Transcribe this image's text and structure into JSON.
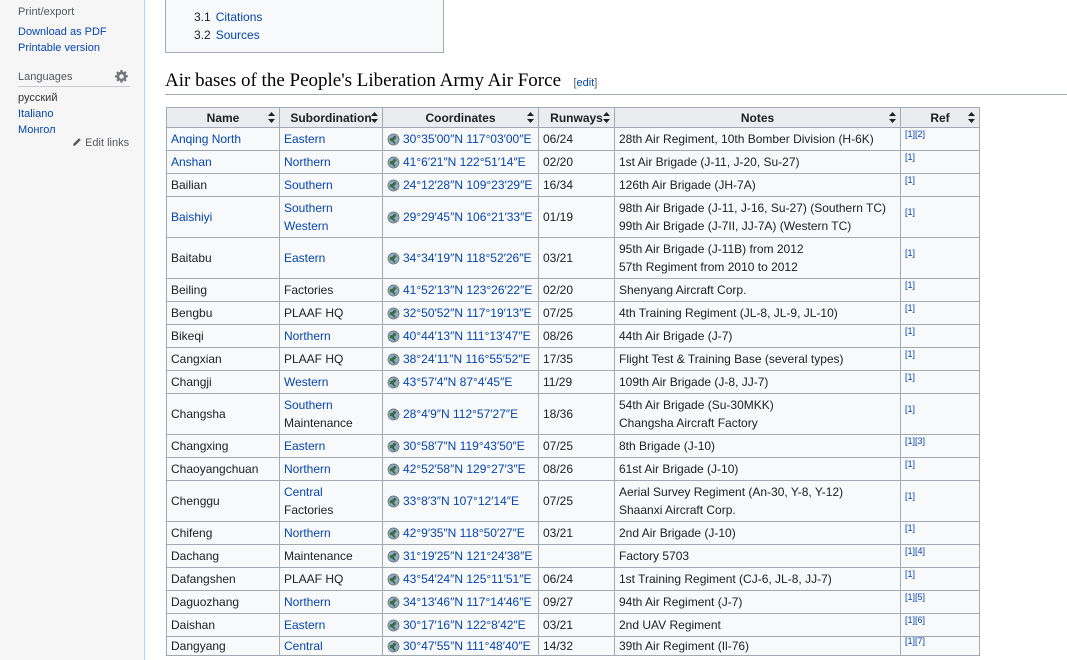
{
  "sidebar": {
    "print_heading": "Print/export",
    "print_links": [
      "Download as PDF",
      "Printable version"
    ],
    "languages_heading": "Languages",
    "languages": [
      "русский",
      "Italiano",
      "Монгол"
    ],
    "edit_links": "Edit links"
  },
  "toc": {
    "items": [
      {
        "num": "3.1",
        "label": "Citations"
      },
      {
        "num": "3.2",
        "label": "Sources"
      }
    ]
  },
  "section": {
    "title": "Air bases of the People's Liberation Army Air Force",
    "edit_open": "[",
    "edit_label": "edit",
    "edit_close": "]"
  },
  "table": {
    "headers": [
      "Name",
      "Subordination",
      "Coordinates",
      "Runways",
      "Notes",
      "Ref"
    ],
    "rows": [
      {
        "name": "Anqing North",
        "name_link": true,
        "sub": [
          "Eastern"
        ],
        "sub_link": [
          true
        ],
        "coords": "30°35′00″N 117°03′00″E",
        "runways": "06/24",
        "notes": [
          "28th Air Regiment, 10th Bomber Division (H-6K)"
        ],
        "ref": "[1][2]"
      },
      {
        "name": "Anshan",
        "name_link": true,
        "sub": [
          "Northern"
        ],
        "sub_link": [
          true
        ],
        "coords": "41°6′21″N 122°51′14″E",
        "runways": "02/20",
        "notes": [
          "1st Air Brigade (J-11, J-20, Su-27)"
        ],
        "ref": "[1]"
      },
      {
        "name": "Bailian",
        "name_link": false,
        "sub": [
          "Southern"
        ],
        "sub_link": [
          true
        ],
        "coords": "24°12′28″N 109°23′29″E",
        "runways": "16/34",
        "notes": [
          "126th Air Brigade (JH-7A)"
        ],
        "ref": "[1]"
      },
      {
        "name": "Baishiyi",
        "name_link": true,
        "sub": [
          "Southern",
          "Western"
        ],
        "sub_link": [
          true,
          true
        ],
        "coords": "29°29′45″N 106°21′33″E",
        "runways": "01/19",
        "notes": [
          "98th Air Brigade (J-11, J-16, Su-27) (Southern TC)",
          "99th Air Brigade (J-7II, JJ-7A) (Western TC)"
        ],
        "ref": "[1]"
      },
      {
        "name": "Baitabu",
        "name_link": false,
        "sub": [
          "Eastern"
        ],
        "sub_link": [
          true
        ],
        "coords": "34°34′19″N 118°52′26″E",
        "runways": "03/21",
        "notes": [
          "95th Air Brigade (J-11B) from 2012",
          "57th Regiment from 2010 to 2012"
        ],
        "ref": "[1]"
      },
      {
        "name": "Beiling",
        "name_link": false,
        "sub": [
          "Factories"
        ],
        "sub_link": [
          false
        ],
        "coords": "41°52′13″N 123°26′22″E",
        "runways": "02/20",
        "notes": [
          "Shenyang Aircraft Corp."
        ],
        "ref": "[1]"
      },
      {
        "name": "Bengbu",
        "name_link": false,
        "sub": [
          "PLAAF HQ"
        ],
        "sub_link": [
          false
        ],
        "coords": "32°50′52″N 117°19′13″E",
        "runways": "07/25",
        "notes": [
          "4th Training Regiment (JL-8, JL-9, JL-10)"
        ],
        "ref": "[1]"
      },
      {
        "name": "Bikeqi",
        "name_link": false,
        "sub": [
          "Northern"
        ],
        "sub_link": [
          true
        ],
        "coords": "40°44′13″N 111°13′47″E",
        "runways": "08/26",
        "notes": [
          "44th Air Brigade (J-7)"
        ],
        "ref": "[1]"
      },
      {
        "name": "Cangxian",
        "name_link": false,
        "sub": [
          "PLAAF HQ"
        ],
        "sub_link": [
          false
        ],
        "coords": "38°24′11″N 116°55′52″E",
        "runways": "17/35",
        "notes": [
          "Flight Test & Training Base (several types)"
        ],
        "ref": "[1]"
      },
      {
        "name": "Changji",
        "name_link": false,
        "sub": [
          "Western"
        ],
        "sub_link": [
          true
        ],
        "coords": "43°57′4″N 87°4′45″E",
        "runways": "11/29",
        "notes": [
          "109th Air Brigade (J-8, JJ-7)"
        ],
        "ref": "[1]"
      },
      {
        "name": "Changsha",
        "name_link": false,
        "sub": [
          "Southern",
          "Maintenance"
        ],
        "sub_link": [
          true,
          false
        ],
        "coords": "28°4′9″N 112°57′27″E",
        "runways": "18/36",
        "notes": [
          "54th Air Brigade (Su-30MKK)",
          "Changsha Aircraft Factory"
        ],
        "ref": "[1]"
      },
      {
        "name": "Changxing",
        "name_link": false,
        "sub": [
          "Eastern"
        ],
        "sub_link": [
          true
        ],
        "coords": "30°58′7″N 119°43′50″E",
        "runways": "07/25",
        "notes": [
          "8th Brigade (J-10)"
        ],
        "ref": "[1][3]"
      },
      {
        "name": "Chaoyangchuan",
        "name_link": false,
        "sub": [
          "Northern"
        ],
        "sub_link": [
          true
        ],
        "coords": "42°52′58″N 129°27′3″E",
        "runways": "08/26",
        "notes": [
          "61st Air Brigade (J-10)"
        ],
        "ref": "[1]"
      },
      {
        "name": "Chenggu",
        "name_link": false,
        "sub": [
          "Central",
          "Factories"
        ],
        "sub_link": [
          true,
          false
        ],
        "coords": "33°8′3″N 107°12′14″E",
        "runways": "07/25",
        "notes": [
          "Aerial Survey Regiment (An-30, Y-8, Y-12)",
          "Shaanxi Aircraft Corp."
        ],
        "ref": "[1]"
      },
      {
        "name": "Chifeng",
        "name_link": false,
        "sub": [
          "Northern"
        ],
        "sub_link": [
          true
        ],
        "coords": "42°9′35″N 118°50′27″E",
        "runways": "03/21",
        "notes": [
          "2nd Air Brigade (J-10)"
        ],
        "ref": "[1]"
      },
      {
        "name": "Dachang",
        "name_link": false,
        "sub": [
          "Maintenance"
        ],
        "sub_link": [
          false
        ],
        "coords": "31°19′25″N 121°24′38″E",
        "runways": "",
        "notes": [
          "Factory 5703"
        ],
        "ref": "[1][4]"
      },
      {
        "name": "Dafangshen",
        "name_link": false,
        "sub": [
          "PLAAF HQ"
        ],
        "sub_link": [
          false
        ],
        "coords": "43°54′24″N 125°11′51″E",
        "runways": "06/24",
        "notes": [
          "1st Training Regiment (CJ-6, JL-8, JJ-7)"
        ],
        "ref": "[1]"
      },
      {
        "name": "Daguozhang",
        "name_link": false,
        "sub": [
          "Northern"
        ],
        "sub_link": [
          true
        ],
        "coords": "34°13′46″N 117°14′46″E",
        "runways": "09/27",
        "notes": [
          "94th Air Regiment (J-7)"
        ],
        "ref": "[1][5]"
      },
      {
        "name": "Daishan",
        "name_link": false,
        "sub": [
          "Eastern"
        ],
        "sub_link": [
          true
        ],
        "coords": "30°17′16″N 122°8′42″E",
        "runways": "03/21",
        "notes": [
          "2nd UAV Regiment"
        ],
        "ref": "[1][6]"
      },
      {
        "name": "Dangyang",
        "name_link": false,
        "sub": [
          "Central"
        ],
        "sub_link": [
          true
        ],
        "coords": "30°47′55″N 111°48′40″E",
        "runways": "14/32",
        "notes": [
          "39th Air Regiment (Il-76)"
        ],
        "ref": "[1][7]"
      }
    ]
  }
}
